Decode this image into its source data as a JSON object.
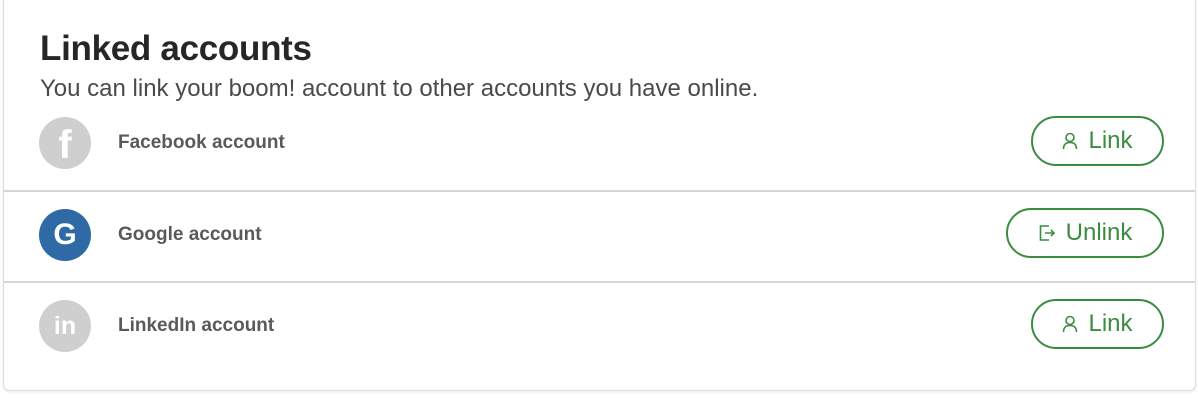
{
  "section": {
    "title": "Linked accounts",
    "subtitle": "You can link your boom! account to other accounts you have online."
  },
  "accounts": [
    {
      "name": "Facebook account",
      "icon": "facebook-icon",
      "glyph": "f",
      "action_label": "Link",
      "action_icon": "user-icon",
      "linked": false
    },
    {
      "name": "Google account",
      "icon": "google-icon",
      "glyph": "G",
      "action_label": "Unlink",
      "action_icon": "sign-out-icon",
      "linked": true
    },
    {
      "name": "LinkedIn account",
      "icon": "linkedin-icon",
      "glyph": "in",
      "action_label": "Link",
      "action_icon": "user-icon",
      "linked": false
    }
  ],
  "colors": {
    "accent": "#3a8c3f",
    "google_brand": "#2f6aa6",
    "inactive_icon": "#cfcfcf"
  }
}
